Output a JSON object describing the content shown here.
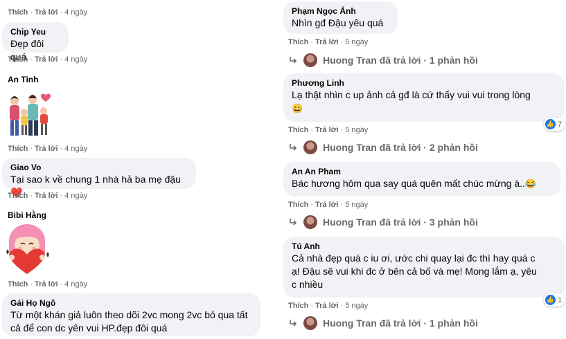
{
  "left": {
    "top_meta": {
      "like": "Thích",
      "reply": "Trả lời",
      "time": "4 ngày"
    },
    "comments": [
      {
        "name": "Chip Yeu",
        "text": "Đẹp đôi quá",
        "like": "Thích",
        "reply": "Trả lời",
        "time": "4 ngày"
      },
      {
        "name": "An Tinh",
        "sticker": "family-sticker",
        "like": "Thích",
        "reply": "Trả lời",
        "time": "4 ngày"
      },
      {
        "name": "Giao Vo",
        "text": "Tại sao k về chung 1 nhà hả ba mẹ đậu",
        "emoji": "❤️",
        "like": "Thích",
        "reply": "Trả lời",
        "time": "4 ngày"
      },
      {
        "name": "Bibi Hằng",
        "sticker": "heart-girl-sticker",
        "like": "Thích",
        "reply": "Trả lời",
        "time": "4 ngày"
      },
      {
        "name": "Gái Họ Ngô",
        "text_line1": "Từ một khán giả luôn theo dõi 2vc mong 2vc bỏ qua tất",
        "text_line2": "cả để con dc yên vui HP.đẹp đôi quá"
      }
    ]
  },
  "right": {
    "comments": [
      {
        "name": "Phạm Ngọc Ánh",
        "text": "Nhìn gđ Đậu yêu quá",
        "like": "Thích",
        "reply": "Trả lời",
        "time": "5 ngày",
        "reply_summary": "Huong Tran đã trả lời · 1 phản hồi"
      },
      {
        "name": "Phương Linh",
        "text": "Lạ thật nhìn c up ảnh cả gđ là cứ thấy vui vui trong lòng",
        "emoji": "😀",
        "reaction_count": "7",
        "like": "Thích",
        "reply": "Trả lời",
        "time": "5 ngày",
        "reply_summary": "Huong Tran đã trả lời · 2 phản hồi"
      },
      {
        "name": "An An Pham",
        "text": "Bác hương hôm qua say quá quên mất chúc mừng à..",
        "emoji": "😂",
        "like": "Thích",
        "reply": "Trả lời",
        "time": "5 ngày",
        "reply_summary": "Huong Tran đã trả lời · 3 phản hồi"
      },
      {
        "name": "Tú Anh",
        "text_line1": "Cả nhà đẹp quá c iu ơi, ước chi quay lại đc thì hay quá c",
        "text_line2": "ạ! Đậu sẽ vui khi đc ở bên cả bố và mẹ! Mong lắm ạ, yêu",
        "text_line3": "c nhiều",
        "reaction_count": "1",
        "like": "Thích",
        "reply": "Trả lời",
        "time": "5 ngày",
        "reply_summary": "Huong Tran đã trả lời · 1 phản hồi"
      }
    ]
  },
  "icons": {
    "like": "thumbs-up-icon",
    "reply_arrow": "reply-arrow-icon"
  },
  "colors": {
    "bubble": "#f0f2f5",
    "meta": "#65676b",
    "like_blue": "#1877f2",
    "heart_red": "#e41e3f"
  }
}
